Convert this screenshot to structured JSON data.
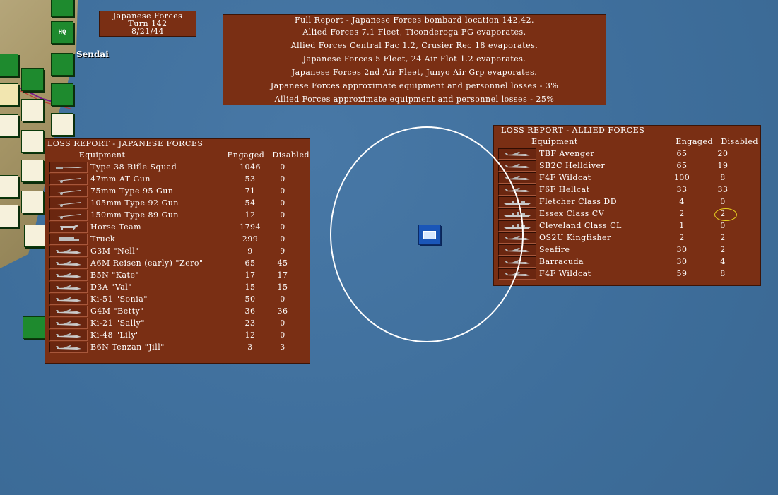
{
  "map": {
    "city_label": "Sendai"
  },
  "turn_box": {
    "side": "Japanese Forces",
    "turn": "Turn 142",
    "date": "8/21/44"
  },
  "full_report": {
    "header": "Full Report -  Japanese Forces bombard location 142,42.",
    "lines": [
      "Allied Forces 7.1 Fleet, Ticonderoga FG evaporates.",
      "Allied Forces Central Pac 1.2, Crusier Rec 18 evaporates.",
      "Japanese Forces 5 Fleet, 24 Air Flot 1.2 evaporates.",
      "Japanese Forces 2nd Air Fleet, Junyo Air Grp evaporates.",
      "Japanese Forces approximate equipment and personnel losses - 3%",
      "Allied Forces approximate equipment and personnel losses - 25%"
    ]
  },
  "japanese_loss": {
    "title": "LOSS REPORT -  JAPANESE FORCES",
    "col_equipment": "Equipment",
    "col_engaged": "Engaged",
    "col_disabled": "Disabled",
    "rows": [
      {
        "icon": "rifle-icon",
        "name": "Type 38 Rifle Squad",
        "engaged": "1046",
        "disabled": "0"
      },
      {
        "icon": "gun-icon",
        "name": "47mm AT Gun",
        "engaged": "53",
        "disabled": "0"
      },
      {
        "icon": "gun-icon",
        "name": "75mm Type 95 Gun",
        "engaged": "71",
        "disabled": "0"
      },
      {
        "icon": "gun-icon",
        "name": "105mm Type 92 Gun",
        "engaged": "54",
        "disabled": "0"
      },
      {
        "icon": "gun-icon",
        "name": "150mm Type 89 Gun",
        "engaged": "12",
        "disabled": "0"
      },
      {
        "icon": "horse-icon",
        "name": "Horse Team",
        "engaged": "1794",
        "disabled": "0"
      },
      {
        "icon": "truck-icon",
        "name": "Truck",
        "engaged": "299",
        "disabled": "0"
      },
      {
        "icon": "aircraft-icon",
        "name": "G3M \"Nell\"",
        "engaged": "9",
        "disabled": "9"
      },
      {
        "icon": "aircraft-icon",
        "name": "A6M Reisen (early) \"Zero\"",
        "engaged": "65",
        "disabled": "45"
      },
      {
        "icon": "aircraft-icon",
        "name": "B5N \"Kate\"",
        "engaged": "17",
        "disabled": "17"
      },
      {
        "icon": "aircraft-icon",
        "name": "D3A \"Val\"",
        "engaged": "15",
        "disabled": "15"
      },
      {
        "icon": "aircraft-icon",
        "name": "Ki-51 \"Sonia\"",
        "engaged": "50",
        "disabled": "0"
      },
      {
        "icon": "aircraft-icon",
        "name": "G4M \"Betty\"",
        "engaged": "36",
        "disabled": "36"
      },
      {
        "icon": "aircraft-icon",
        "name": "Ki-21 \"Sally\"",
        "engaged": "23",
        "disabled": "0"
      },
      {
        "icon": "aircraft-icon",
        "name": "Ki-48 \"Lily\"",
        "engaged": "12",
        "disabled": "0"
      },
      {
        "icon": "aircraft-icon",
        "name": "B6N Tenzan \"Jill\"",
        "engaged": "3",
        "disabled": "3"
      }
    ]
  },
  "allied_loss": {
    "title": "LOSS REPORT -  ALLIED FORCES",
    "col_equipment": "Equipment",
    "col_engaged": "Engaged",
    "col_disabled": "Disabled",
    "rows": [
      {
        "icon": "aircraft-icon",
        "name": "TBF Avenger",
        "engaged": "65",
        "disabled": "20"
      },
      {
        "icon": "aircraft-icon",
        "name": "SB2C Helldiver",
        "engaged": "65",
        "disabled": "19"
      },
      {
        "icon": "aircraft-icon",
        "name": "F4F Wildcat",
        "engaged": "100",
        "disabled": "8"
      },
      {
        "icon": "aircraft-icon",
        "name": "F6F Hellcat",
        "engaged": "33",
        "disabled": "33"
      },
      {
        "icon": "ship-icon",
        "name": "Fletcher Class DD",
        "engaged": "4",
        "disabled": "0"
      },
      {
        "icon": "ship-icon",
        "name": "Essex Class CV",
        "engaged": "2",
        "disabled": "2"
      },
      {
        "icon": "ship-icon",
        "name": "Cleveland Class CL",
        "engaged": "1",
        "disabled": "0"
      },
      {
        "icon": "aircraft-icon",
        "name": "OS2U Kingfisher",
        "engaged": "2",
        "disabled": "2"
      },
      {
        "icon": "aircraft-icon",
        "name": "Seafire",
        "engaged": "30",
        "disabled": "2"
      },
      {
        "icon": "aircraft-icon",
        "name": "Barracuda",
        "engaged": "30",
        "disabled": "4"
      },
      {
        "icon": "aircraft-icon",
        "name": "F4F Wildcat",
        "engaged": "59",
        "disabled": "8"
      }
    ]
  },
  "unit_labels": {
    "hq": "HQ"
  }
}
